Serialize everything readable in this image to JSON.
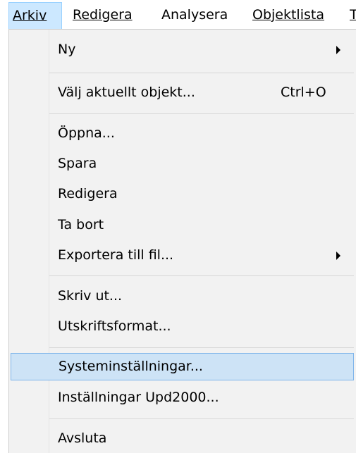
{
  "menubar": {
    "items": [
      {
        "label": "Arkiv",
        "accelerator": "A",
        "active": true
      },
      {
        "label": "Redigera",
        "accelerator": "R"
      },
      {
        "label": "Analysera",
        "accelerator": "y"
      },
      {
        "label": "Objektlista",
        "accelerator": "O"
      },
      {
        "label": "T",
        "accelerator": "T"
      }
    ],
    "active_bg": "#cce8ff"
  },
  "menu": {
    "background": "#f2f2f2",
    "highlight_color": "#cde3f6",
    "items": [
      {
        "label": "Ny",
        "submenu": true
      },
      {
        "label": "Välj aktuellt objekt...",
        "shortcut": "Ctrl+O"
      },
      {
        "label": "Öppna..."
      },
      {
        "label": "Spara"
      },
      {
        "label": "Redigera"
      },
      {
        "label": "Ta bort"
      },
      {
        "label": "Exportera till fil...",
        "submenu": true
      },
      {
        "label": "Skriv ut..."
      },
      {
        "label": "Utskriftsformat..."
      },
      {
        "label": "Systeminställningar...",
        "highlighted": true
      },
      {
        "label": "Inställningar Upd2000..."
      },
      {
        "label": "Avsluta"
      }
    ]
  }
}
